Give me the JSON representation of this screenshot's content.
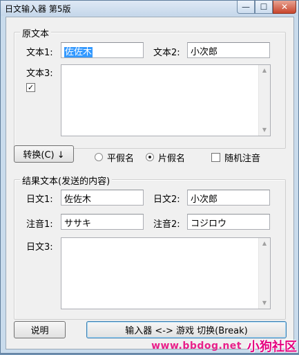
{
  "window": {
    "title": "日文输入器 第5版",
    "minimize_glyph": "—",
    "maximize_glyph": "☐",
    "close_glyph": "✕"
  },
  "source": {
    "group_label": "原文本",
    "text1_label": "文本1:",
    "text1_value": "佐佐木",
    "text2_label": "文本2:",
    "text2_value": "小次郎",
    "text3_label": "文本3:",
    "text3_value": "",
    "checkbox_mark": "✓"
  },
  "controls": {
    "convert_label": "转换(C) ↓",
    "hiragana_label": "平假名",
    "katakana_label": "片假名",
    "random_label": "随机注音",
    "selected_kana": "katakana"
  },
  "result": {
    "group_label": "结果文本(发送的内容)",
    "jp1_label": "日文1:",
    "jp1_value": "佐佐木",
    "jp2_label": "日文2:",
    "jp2_value": "小次郎",
    "note1_label": "注音1:",
    "note1_value": "ササキ",
    "note2_label": "注音2:",
    "note2_value": "コジロウ",
    "jp3_label": "日文3:",
    "jp3_value": ""
  },
  "footer": {
    "help_label": "说明",
    "toggle_label": "输入器 <-> 游戏 切换(Break)"
  },
  "watermark": {
    "url": "www.bbdog.net",
    "brand": "小狗社区"
  }
}
